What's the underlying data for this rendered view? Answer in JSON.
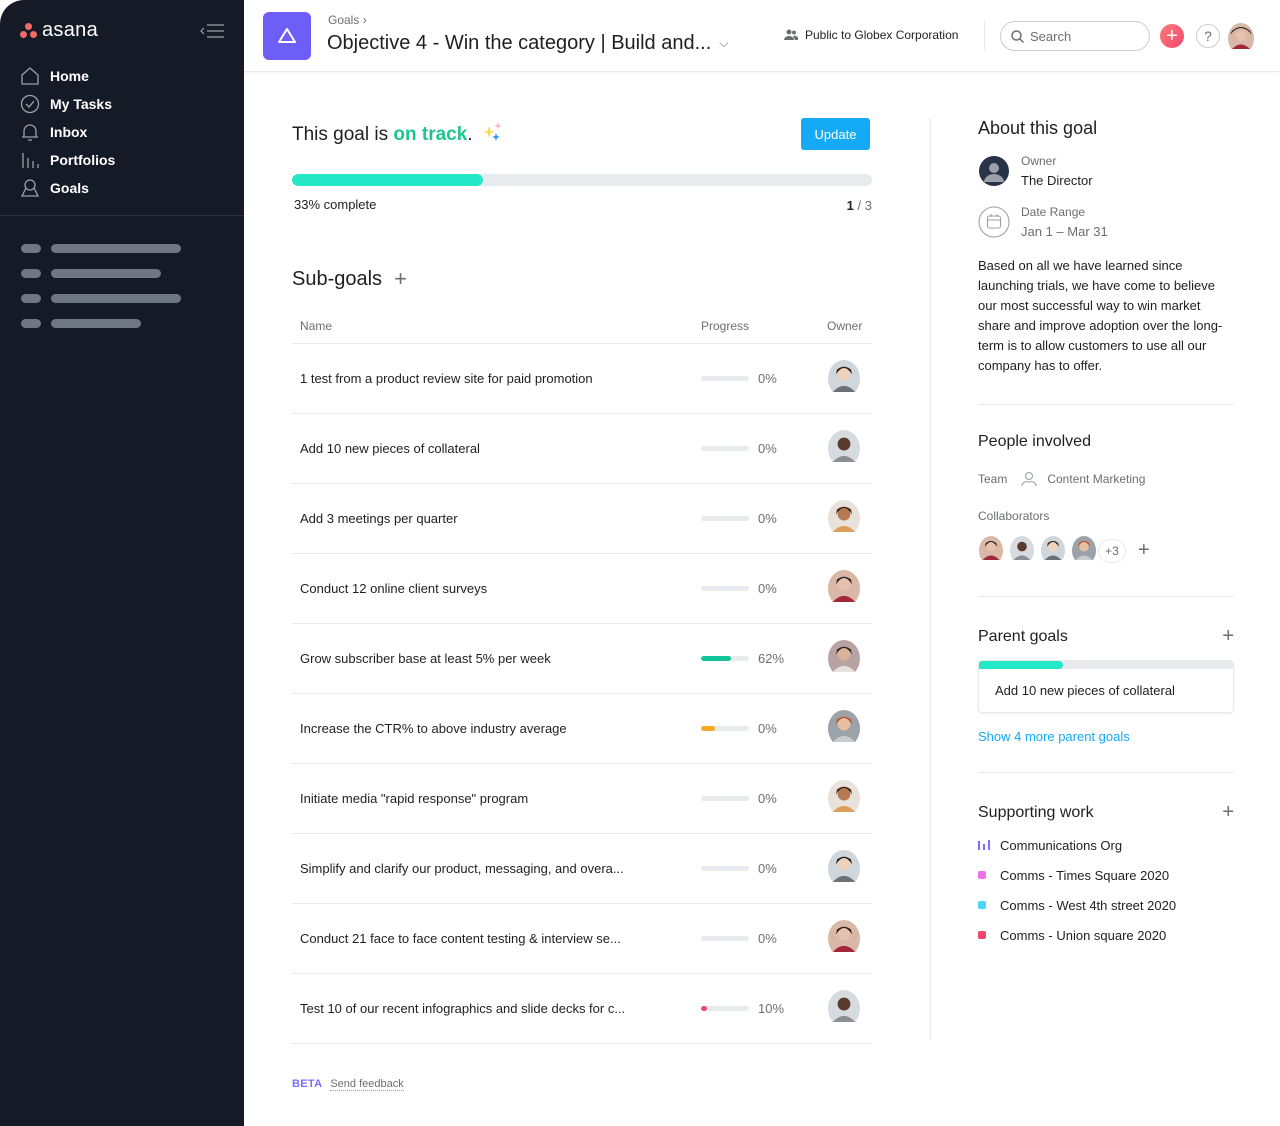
{
  "sidebar": {
    "brand": "asana",
    "collapse_icon": "collapse-sidebar-icon",
    "nav": [
      {
        "label": "Home",
        "icon": "home-icon"
      },
      {
        "label": "My Tasks",
        "icon": "check-circle-icon"
      },
      {
        "label": "Inbox",
        "icon": "bell-icon"
      },
      {
        "label": "Portfolios",
        "icon": "portfolios-icon"
      },
      {
        "label": "Goals",
        "icon": "goals-icon"
      }
    ]
  },
  "header": {
    "breadcrumb": "Goals",
    "title": "Objective 4 - Win the category | Build and...",
    "privacy": "Public to Globex Corporation",
    "search_placeholder": "Search",
    "help": "?"
  },
  "status": {
    "prefix": "This goal is ",
    "state": "on track",
    "suffix": ".",
    "update_label": "Update",
    "progress_pct": 33,
    "progress_label": "33% complete",
    "completed": "1",
    "total": "/ 3",
    "colors": {
      "on_track": "#1ec68f",
      "bar": "#25e8c8"
    }
  },
  "subgoals": {
    "title": "Sub-goals",
    "columns": {
      "name": "Name",
      "progress": "Progress",
      "owner": "Owner"
    },
    "rows": [
      {
        "name": "1 test from a product review site for paid promotion",
        "progress": 0,
        "progress_label": "0%",
        "bar_color": "#e8ebee",
        "owner_avatar": "asian-woman"
      },
      {
        "name": "Add 10 new pieces of collateral",
        "progress": 0,
        "progress_label": "0%",
        "bar_color": "#e8ebee",
        "owner_avatar": "bald-man"
      },
      {
        "name": "Add 3 meetings per quarter",
        "progress": 0,
        "progress_label": "0%",
        "bar_color": "#e8ebee",
        "owner_avatar": "curly-woman"
      },
      {
        "name": "Conduct 12 online client surveys",
        "progress": 0,
        "progress_label": "0%",
        "bar_color": "#e8ebee",
        "owner_avatar": "hat-woman"
      },
      {
        "name": "Grow subscriber base at least 5% per week",
        "progress": 62,
        "progress_label": "62%",
        "bar_color": "#13c49a",
        "owner_avatar": "glasses-man"
      },
      {
        "name": "Increase the CTR% to above industry average",
        "progress": 30,
        "progress_label": "0%",
        "bar_color": "#f5a623",
        "owner_avatar": "redhead-man"
      },
      {
        "name": "Initiate media \"rapid response\" program",
        "progress": 0,
        "progress_label": "0%",
        "bar_color": "#e8ebee",
        "owner_avatar": "curly-woman"
      },
      {
        "name": "Simplify and clarify our product, messaging, and overa...",
        "progress": 0,
        "progress_label": "0%",
        "bar_color": "#e8ebee",
        "owner_avatar": "asian-woman"
      },
      {
        "name": "Conduct 21 face to face content testing & interview se...",
        "progress": 0,
        "progress_label": "0%",
        "bar_color": "#e8ebee",
        "owner_avatar": "hat-woman"
      },
      {
        "name": "Test 10 of our recent infographics and slide decks for c...",
        "progress": 10,
        "progress_label": "10%",
        "bar_color": "#f0476b",
        "owner_avatar": "bald-man"
      }
    ]
  },
  "footer": {
    "beta": "BETA",
    "feedback": "Send feedback"
  },
  "about": {
    "title": "About this goal",
    "owner_label": "Owner",
    "owner": "The Director",
    "date_label": "Date Range",
    "date": "Jan 1 – Mar 31",
    "description": "Based on all we have learned since launching trials, we have come to believe our most successful way to win market share and improve adoption over the long-term is to allow customers to use all our company has to offer."
  },
  "people": {
    "title": "People involved",
    "team_label": "Team",
    "team": "Content Marketing",
    "collab_label": "Collaborators",
    "collaborators": [
      "hat-woman",
      "bald-man",
      "asian-woman",
      "redhead-man"
    ],
    "more": "+3"
  },
  "parent_goals": {
    "title": "Parent goals",
    "card": {
      "name": "Add 10 new pieces of collateral",
      "progress": 33
    },
    "show_more": "Show 4 more parent goals"
  },
  "supporting": {
    "title": "Supporting work",
    "items": [
      {
        "label": "Communications Org",
        "type": "portfolio",
        "color": "#796eff"
      },
      {
        "label": "Comms - Times Square 2020",
        "type": "project",
        "color": "#f26fe7"
      },
      {
        "label": "Comms - West 4th street 2020",
        "type": "project",
        "color": "#4bd6f9"
      },
      {
        "label": "Comms - Union square 2020",
        "type": "project",
        "color": "#f0476b"
      }
    ]
  }
}
